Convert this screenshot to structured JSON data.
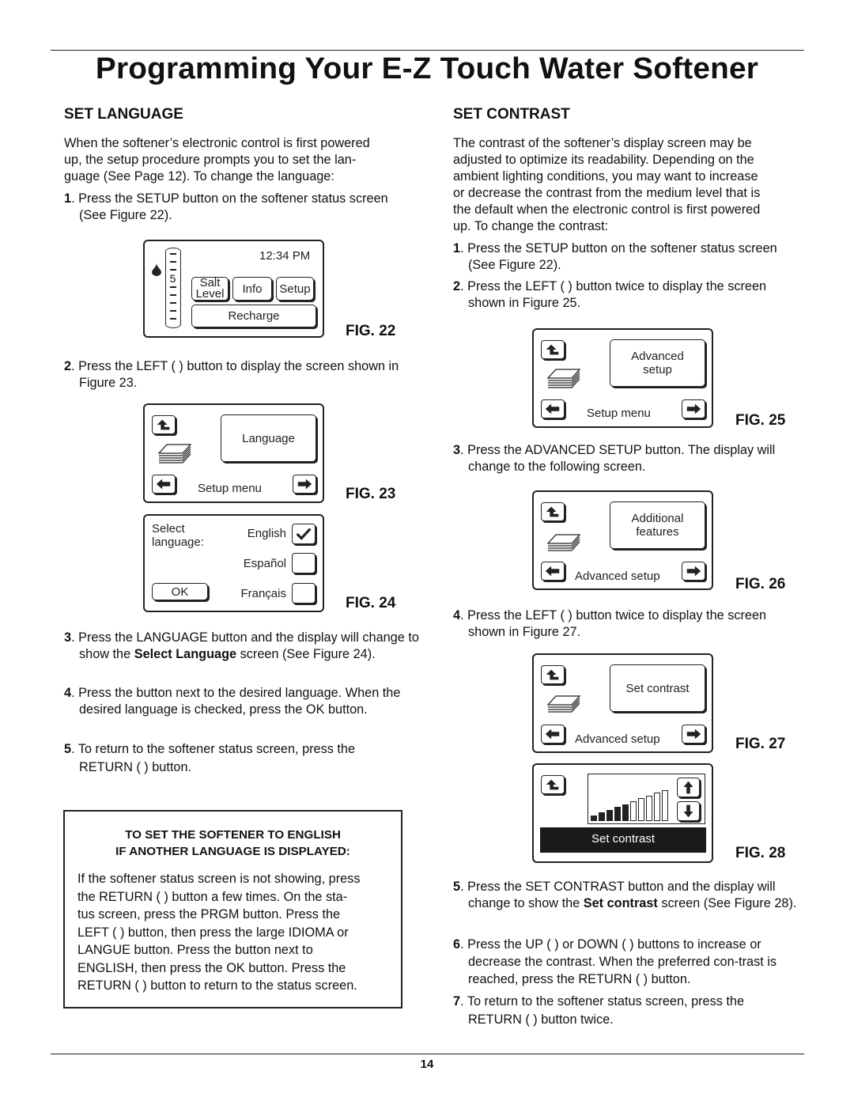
{
  "page": {
    "title": "Programming Your E-Z Touch Water Softener",
    "page_number": "14"
  },
  "left": {
    "heading": "SET LANGUAGE",
    "intro": [
      "When the softener’s electronic control is first powered",
      "up, the setup procedure prompts you to set the lan-",
      "guage (See Page 12).  To change the language:"
    ],
    "step1": {
      "n": "1",
      "text": ". Press the SETUP button on the softener status screen (See Figure 22)."
    },
    "step2": {
      "n": "2",
      "text": ". Press the LEFT (    ) button to display the screen shown in Figure 23."
    },
    "step3": {
      "n": "3",
      "pre": ". Press the LANGUAGE button and the display will change to show the ",
      "bold": "Select Language",
      "post": " screen (See Figure 24)."
    },
    "step4": {
      "n": "4",
      "text": ". Press the button next to the desired language. When the desired language is checked, press the OK button."
    },
    "step5": {
      "n": "5",
      "text": ". To return to the softener status screen, press the RETURN (    ) button."
    }
  },
  "fig22": {
    "label": "FIG. 22",
    "time": "12:34 PM",
    "salt_level_value": "5",
    "icons": [
      "water-drop-icon",
      "salt-level-gauge"
    ],
    "buttons": {
      "salt_level_1": "Salt",
      "salt_level_2": "Level",
      "info": "Info",
      "setup": "Setup",
      "recharge": "Recharge"
    }
  },
  "fig23": {
    "label": "FIG. 23",
    "main_button": "Language",
    "footer": "Setup menu",
    "icons": [
      "return-icon",
      "menu-stack-icon",
      "left-arrow-icon",
      "right-arrow-icon"
    ]
  },
  "fig24": {
    "label": "FIG. 24",
    "prompt_1": "Select",
    "prompt_2": "language:",
    "options": [
      {
        "label": "English",
        "checked": true
      },
      {
        "label": "Español",
        "checked": false
      },
      {
        "label": "Français",
        "checked": false
      }
    ],
    "ok": "OK"
  },
  "note": {
    "heading_1": "TO SET THE SOFTENER TO ENGLISH",
    "heading_2": "IF ANOTHER LANGUAGE IS DISPLAYED:",
    "lines": [
      "If the softener status screen is not showing, press",
      "the RETURN (    ) button a few times.  On the sta-",
      "tus screen, press the PRGM button.  Press the",
      "LEFT (    ) button, then press the large IDIOMA or",
      "LANGUE button.  Press the button next to",
      "ENGLISH, then press the OK button.  Press the",
      "RETURN (    ) button to return to the status screen."
    ]
  },
  "right": {
    "heading": "SET CONTRAST",
    "intro": [
      "The contrast of the softener’s display screen may be",
      "adjusted to optimize its readability.  Depending on the",
      "ambient lighting conditions, you may want to increase",
      "or decrease the contrast from the medium level that is",
      "the default when the electronic control is first powered",
      "up.  To change the contrast:"
    ],
    "step1": {
      "n": "1",
      "text": ". Press the SETUP button on the softener status screen (See Figure 22)."
    },
    "step2": {
      "n": "2",
      "text": ". Press the LEFT (    ) button twice to display the screen shown in Figure 25."
    },
    "step3": {
      "n": "3",
      "text": ". Press the ADVANCED SETUP button.  The display will change to the following screen."
    },
    "step4": {
      "n": "4",
      "text": ". Press the LEFT (    ) button twice to display the screen shown in Figure 27."
    },
    "step5": {
      "n": "5",
      "pre": ". Press the SET CONTRAST button and the display will change to show the ",
      "bold": "Set contrast",
      "post": " screen (See Figure 28)."
    },
    "step6": {
      "n": "6",
      "text": ". Press the UP (    ) or DOWN (    ) buttons to increase or decrease the contrast.  When the preferred con-trast is reached, press the RETURN (    ) button."
    },
    "step7": {
      "n": "7",
      "text": ". To return to the softener status screen, press the RETURN (    ) button twice."
    }
  },
  "fig25": {
    "label": "FIG. 25",
    "main_button_1": "Advanced",
    "main_button_2": "setup",
    "footer": "Setup menu"
  },
  "fig26": {
    "label": "FIG. 26",
    "main_button_1": "Additional",
    "main_button_2": "features",
    "footer": "Advanced setup"
  },
  "fig27": {
    "label": "FIG. 27",
    "main_button": "Set contrast",
    "footer": "Advanced setup"
  },
  "fig28": {
    "label": "FIG. 28",
    "footer": "Set contrast",
    "contrast_level": 5,
    "contrast_max": 10,
    "icons": [
      "return-icon",
      "up-arrow-icon",
      "down-arrow-icon"
    ]
  }
}
